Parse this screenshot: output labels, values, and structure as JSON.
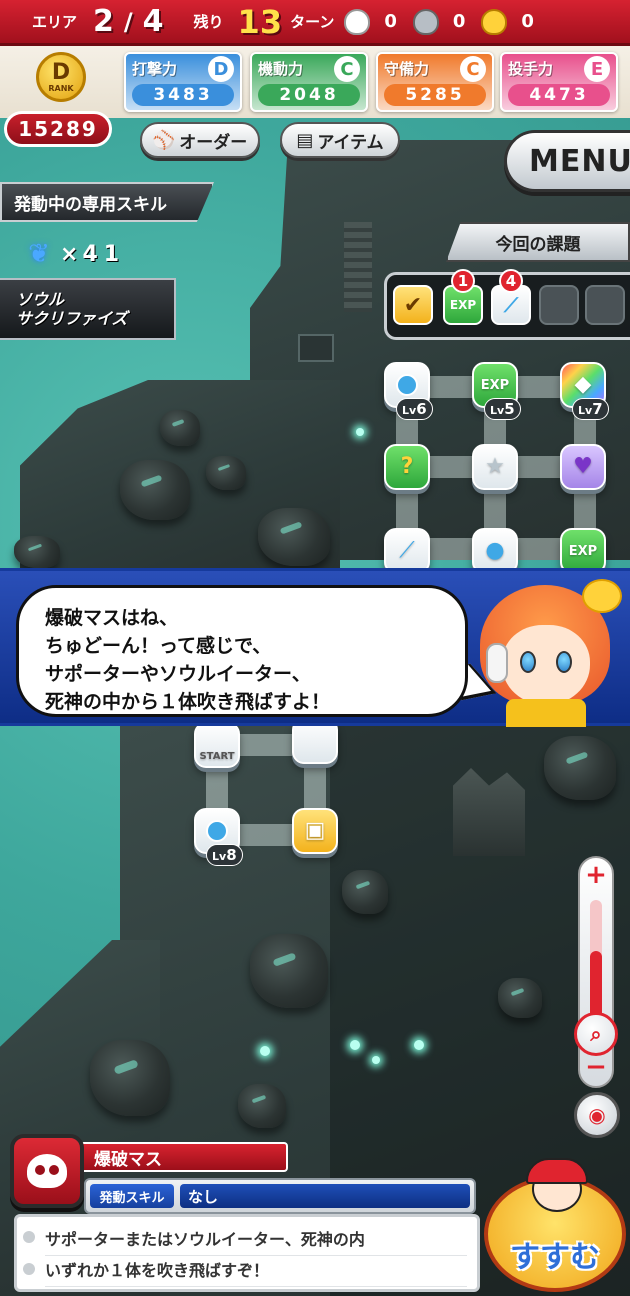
{
  "hud": {
    "area_label": "エリア",
    "area_current": "2",
    "area_sep": "/",
    "area_total": "4",
    "remain_label": "残り",
    "turns": "13",
    "turn_label": "ターン",
    "bag_white_count": "0",
    "bag_silver_count": "0",
    "bag_gold_count": "0"
  },
  "rank": {
    "letter": "D",
    "label": "RANK",
    "score": "15289"
  },
  "stats": [
    {
      "name": "打撃力",
      "grade": "D",
      "value": "3483",
      "color": "#3a8fdc"
    },
    {
      "name": "機動力",
      "grade": "C",
      "value": "2048",
      "color": "#3aa85a"
    },
    {
      "name": "守備力",
      "grade": "C",
      "value": "5285",
      "color": "#f07a2c"
    },
    {
      "name": "投手力",
      "grade": "E",
      "value": "4473",
      "color": "#e8508c"
    }
  ],
  "buttons": {
    "order": "オーダー",
    "item": "アイテム",
    "menu": "MENU",
    "advance": "すすむ"
  },
  "tags": {
    "active_skill": "発動中の専用スキル",
    "task": "今回の課題"
  },
  "soul": {
    "count_prefix": "×",
    "count": "41",
    "line1": "ソウル",
    "line2": "サクリファイズ"
  },
  "task_badges": {
    "exp": "1",
    "bat": "4",
    "exp_label": "EXP"
  },
  "tiles": {
    "exp_label": "EXP",
    "lv_prefix": "Lv",
    "lv_ball": "6",
    "lv_exp": "5",
    "lv_rainbow": "7",
    "lv_ball_bottom": "8",
    "start": "START"
  },
  "dialog": {
    "line1": "爆破マスはね、",
    "line2": "ちゅどーん！って感じで、",
    "line3": "サポーターやソウルイーター、",
    "line4": "死神の中から１体吹き飛ばすよ！"
  },
  "info": {
    "title": "爆破マス",
    "skill_label": "発動スキル",
    "skill_value": "なし",
    "desc1": "サポーターまたはソウルイーター、死神の内",
    "desc2": "いずれか１体を吹き飛ばすぞ！"
  },
  "zoom": {
    "plus": "+",
    "minus": "−",
    "level": 0.65
  },
  "colors": {
    "accent_red": "#d62231",
    "dialog_blue": "#1d3fa0"
  }
}
